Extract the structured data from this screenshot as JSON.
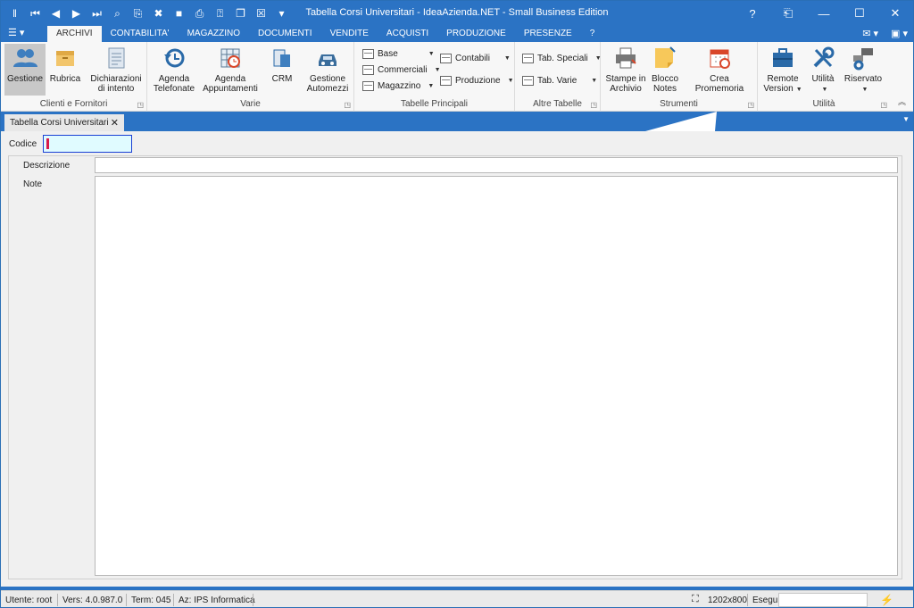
{
  "window": {
    "title": "Tabella Corsi Universitari - IdeaAzienda.NET - Small Business Edition",
    "help": "?",
    "restore_icon": "⎗",
    "minimize": "—",
    "maximize": "☐",
    "close": "✕"
  },
  "quick_access": [
    "‖",
    "⏮",
    "◀",
    "▶",
    "⏭",
    "⌕",
    "⎘",
    "✖",
    "■",
    "⎙",
    "⍰",
    "❐",
    "☒",
    "▾"
  ],
  "app_menu": "☰ ▾",
  "tabs": [
    {
      "label": "ARCHIVI",
      "active": true
    },
    {
      "label": "CONTABILITA'"
    },
    {
      "label": "MAGAZZINO"
    },
    {
      "label": "DOCUMENTI"
    },
    {
      "label": "VENDITE"
    },
    {
      "label": "ACQUISTI"
    },
    {
      "label": "PRODUZIONE"
    },
    {
      "label": "PRESENZE"
    },
    {
      "label": "?"
    }
  ],
  "tabs_right": {
    "mail": "✉ ▾",
    "windows": "▣ ▾"
  },
  "ribbon": {
    "clienti": {
      "title": "Clienti e Fornitori",
      "gestione": "Gestione",
      "rubrica": "Rubrica",
      "dichiarazioni": [
        "Dichiarazioni",
        "di intento"
      ]
    },
    "varie": {
      "title": "Varie",
      "agenda_tel": [
        "Agenda",
        "Telefonate"
      ],
      "agenda_app": [
        "Agenda",
        "Appuntamenti"
      ],
      "crm": "CRM",
      "automezzi": [
        "Gestione",
        "Automezzi"
      ]
    },
    "tabelle": {
      "title": "Tabelle Principali",
      "base": "Base",
      "commerciali": "Commerciali",
      "magazzino": "Magazzino",
      "contabili": "Contabili",
      "produzione": "Produzione"
    },
    "altre": {
      "title": "Altre Tabelle",
      "speciali": "Tab. Speciali",
      "varie": "Tab. Varie"
    },
    "strumenti": {
      "title": "Strumenti",
      "stampe": [
        "Stampe in",
        "Archivio"
      ],
      "blocco": [
        "Blocco",
        "Notes"
      ],
      "promemoria": "Crea Promemoria"
    },
    "utilita": {
      "title": "Utilità",
      "remote": [
        "Remote",
        "Version"
      ],
      "utilita": "Utilità",
      "riservato": "Riservato"
    }
  },
  "document_tab": {
    "label": "Tabella Corsi Universitari",
    "close": "✕"
  },
  "form": {
    "codice_label": "Codice",
    "descrizione_label": "Descrizione",
    "note_label": "Note",
    "codice_value": "",
    "descrizione_value": "",
    "note_value": ""
  },
  "status": {
    "utente": "Utente: root",
    "versione": "Vers: 4.0.987.0",
    "terminale": "Term: 045",
    "azienda": "Az: IPS Informatica",
    "resolution": "1202x800",
    "esegui_label": "Esegui",
    "esegui_value": ""
  },
  "colors": {
    "titlebar": "#2b73c4",
    "accent": "#2b73c4",
    "codice_bg": "#e0fbff"
  }
}
